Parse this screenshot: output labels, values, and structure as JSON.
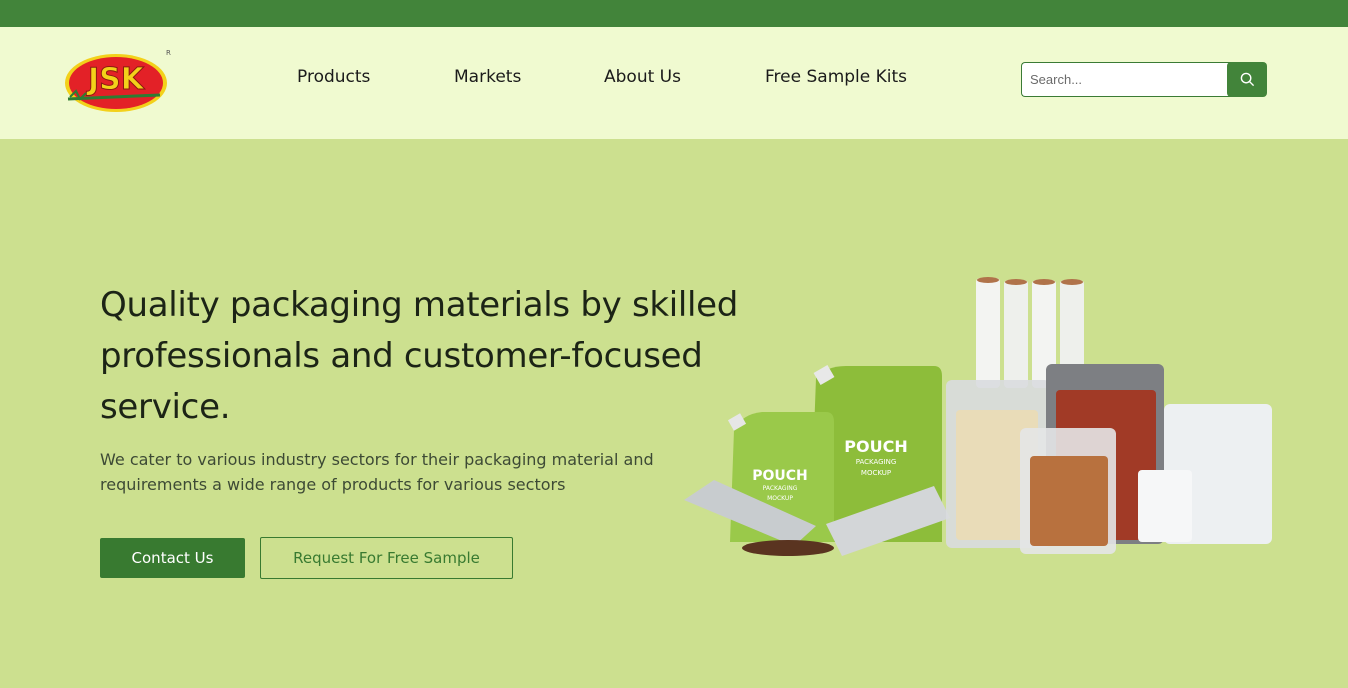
{
  "brand": {
    "logo_text": "JSK",
    "registered_mark": "R"
  },
  "nav": {
    "items": [
      {
        "label": "Products"
      },
      {
        "label": "Markets"
      },
      {
        "label": "About Us"
      },
      {
        "label": "Free Sample Kits"
      }
    ]
  },
  "search": {
    "placeholder": "Search...",
    "button_icon": "search-icon"
  },
  "hero": {
    "title": "Quality packaging materials by skilled professionals and customer-focused service.",
    "subtitle": "We cater to various industry sectors for their packaging material and requirements a wide range of products for various sectors",
    "contact_label": "Contact Us",
    "sample_label": "Request For Free Sample",
    "image": {
      "pouch_label_1": "POUCH",
      "pouch_label_2": "PACKAGING",
      "pouch_label_3": "MOCKUP"
    }
  },
  "colors": {
    "topbar": "#42843a",
    "header_bg": "#f0fad0",
    "hero_bg": "#cce08f",
    "accent": "#387a30"
  }
}
